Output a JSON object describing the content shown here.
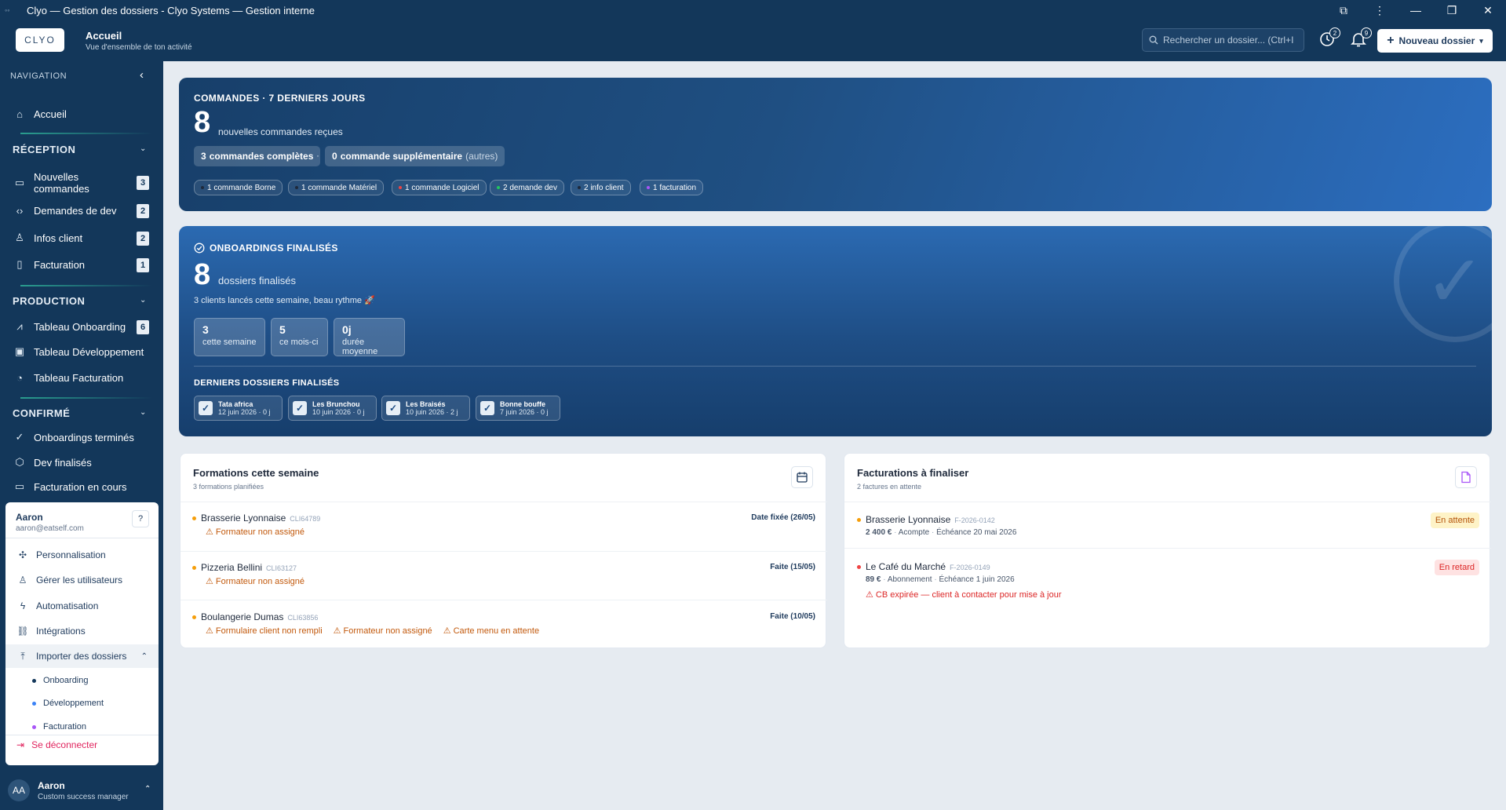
{
  "window": {
    "title": "Clyo — Gestion des dossiers - Clyo Systems — Gestion interne",
    "controls": [
      "⧉",
      "⋮",
      "—",
      "❐",
      "✕"
    ]
  },
  "header": {
    "brand": "CLYO",
    "title": "Accueil",
    "subtitle": "Vue d'ensemble de ton activité",
    "search_placeholder": "Rechercher un dossier...  (Ctrl+I",
    "history_count": "2",
    "notif_count": "9",
    "new_button": "Nouveau dossier"
  },
  "sidebar": {
    "nav_header": "NAVIGATION",
    "home": "Accueil",
    "sections": [
      {
        "title": "RÉCEPTION",
        "items": [
          {
            "label": "Nouvelles commandes",
            "badge": "3",
            "icon": "inbox-icon"
          },
          {
            "label": "Demandes de dev",
            "badge": "2",
            "icon": "code-icon"
          },
          {
            "label": "Infos client",
            "badge": "2",
            "icon": "user-icon"
          },
          {
            "label": "Facturation",
            "badge": "1",
            "icon": "file-icon"
          }
        ]
      },
      {
        "title": "PRODUCTION",
        "items": [
          {
            "label": "Tableau Onboarding",
            "badge": "6",
            "icon": "chart-icon"
          },
          {
            "label": "Tableau Développement",
            "badge": "",
            "icon": "box-icon"
          },
          {
            "label": "Tableau Facturation",
            "badge": "",
            "icon": "gauge-icon"
          }
        ]
      },
      {
        "title": "CONFIRMÉ",
        "items": [
          {
            "label": "Onboardings terminés",
            "badge": "",
            "icon": "check-icon"
          },
          {
            "label": "Dev finalisés",
            "badge": "",
            "icon": "hexagon-icon"
          },
          {
            "label": "Facturation en cours",
            "badge": "",
            "icon": "card-icon"
          }
        ]
      }
    ]
  },
  "user_menu": {
    "name": "Aaron",
    "email": "aaron@eatself.com",
    "help": "?",
    "items": [
      "Personnalisation",
      "Gérer les utilisateurs",
      "Automatisation",
      "Intégrations",
      "Importer des dossiers"
    ],
    "import_sub": [
      {
        "label": "Onboarding",
        "color": "#13375a"
      },
      {
        "label": "Développement",
        "color": "#3b82f6"
      },
      {
        "label": "Facturation",
        "color": "#a855f7"
      }
    ],
    "logout": "Se déconnecter"
  },
  "profile": {
    "initials": "AA",
    "name": "Aaron",
    "role": "Custom success manager"
  },
  "orders": {
    "title": "COMMANDES · 7 DERNIERS JOURS",
    "count": "8",
    "count_label": "nouvelles commandes reçues",
    "complete_num": "3",
    "complete_label": "commandes complètes",
    "extra_num": "0",
    "extra_label": "commande supplémentaire",
    "extra_note": "(autres)",
    "sep": "·",
    "tags": [
      {
        "label": "1 commande Borne",
        "color": "#1e293b"
      },
      {
        "label": "1 commande Matériel",
        "color": "#1e293b"
      },
      {
        "label": "1 commande Logiciel",
        "color": "#ef4444"
      },
      {
        "label": "2 demande dev",
        "color": "#22c55e"
      },
      {
        "label": "2 info client",
        "color": "#1e293b"
      },
      {
        "label": "1 facturation",
        "color": "#a855f7"
      }
    ]
  },
  "onboardings": {
    "title": "ONBOARDINGS FINALISÉS",
    "count": "8",
    "count_label": "dossiers finalisés",
    "note": "3 clients lancés cette semaine, beau rythme 🚀",
    "stats": [
      {
        "value": "3",
        "label": "cette semaine"
      },
      {
        "value": "5",
        "label": "ce mois-ci"
      },
      {
        "value": "0j",
        "label": "durée moyenne"
      }
    ],
    "recent_title": "DERNIERS DOSSIERS FINALISÉS",
    "recent": [
      {
        "name": "Tata africa",
        "date": "12 juin 2026 · 0 j"
      },
      {
        "name": "Les Brunchou",
        "date": "10 juin 2026 · 0 j"
      },
      {
        "name": "Les Braisés",
        "date": "10 juin 2026 · 2 j"
      },
      {
        "name": "Bonne bouffe",
        "date": "7 juin 2026 · 0 j"
      }
    ]
  },
  "trainings": {
    "title": "Formations cette semaine",
    "subtitle": "3 formations planifiées",
    "rows": [
      {
        "name": "Brasserie Lyonnaise",
        "code": "CLI64789",
        "status": "Date fixée (26/05)",
        "warnings": [
          "⚠ Formateur non assigné"
        ]
      },
      {
        "name": "Pizzeria Bellini",
        "code": "CLI63127",
        "status": "Faite (15/05)",
        "warnings": [
          "⚠ Formateur non assigné"
        ]
      },
      {
        "name": "Boulangerie Dumas",
        "code": "CLI63856",
        "status": "Faite (10/05)",
        "warnings": [
          "⚠ Formulaire client non rempli",
          "⚠ Formateur non assigné",
          "⚠ Carte menu en attente"
        ]
      }
    ]
  },
  "invoices": {
    "title": "Facturations à finaliser",
    "subtitle": "2 factures en attente",
    "rows": [
      {
        "name": "Brasserie Lyonnaise",
        "ref": "F-2026-0142",
        "amount": "2 400 €",
        "type": "Acompte",
        "due": "Échéance 20 mai 2026",
        "status": "En attente",
        "alert": "",
        "bullet": "#f59e0b"
      },
      {
        "name": "Le Café du Marché",
        "ref": "F-2026-0149",
        "amount": "89 €",
        "type": "Abonnement",
        "due": "Échéance 1 juin 2026",
        "status": "En retard",
        "alert": "⚠ CB expirée — client à contacter pour mise à jour",
        "bullet": "#ef4444"
      }
    ],
    "dot": "·"
  }
}
